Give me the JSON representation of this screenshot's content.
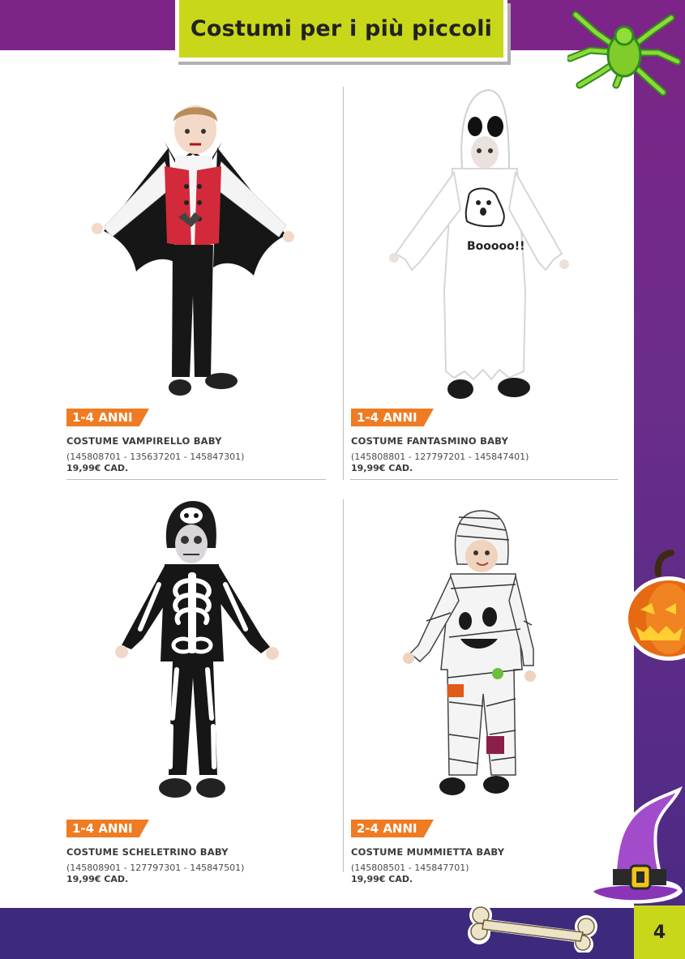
{
  "header": {
    "title": "Costumi per i più piccoli"
  },
  "page_number": "4",
  "products": [
    {
      "age": "1-4 ANNI",
      "name": "COSTUME VAMPIRELLO BABY",
      "codes": "(145808701 - 135637201 - 145847301)",
      "price": "19,99€ CAD."
    },
    {
      "age": "1-4 ANNI",
      "name": "COSTUME FANTASMINO BABY",
      "codes": "(145808801 - 127797201 - 145847401)",
      "price": "19,99€ CAD.",
      "costume_text": "Booooo!!"
    },
    {
      "age": "1-4 ANNI",
      "name": "COSTUME SCHELETRINO BABY",
      "codes": "(145808901 - 127797301 - 145847501)",
      "price": "19,99€ CAD."
    },
    {
      "age": "2-4 ANNI",
      "name": "COSTUME MUMMIETTA BABY",
      "codes": "(145808501 - 145847701)",
      "price": "19,99€ CAD."
    }
  ],
  "colors": {
    "banner_purple": "#7d2488",
    "title_green": "#c9d71a",
    "age_orange": "#ef7b22",
    "bottom_purple": "#3d2a7d"
  },
  "decorations": [
    "spider-icon",
    "pumpkin-icon",
    "witch-hat-icon",
    "bone-icon"
  ]
}
